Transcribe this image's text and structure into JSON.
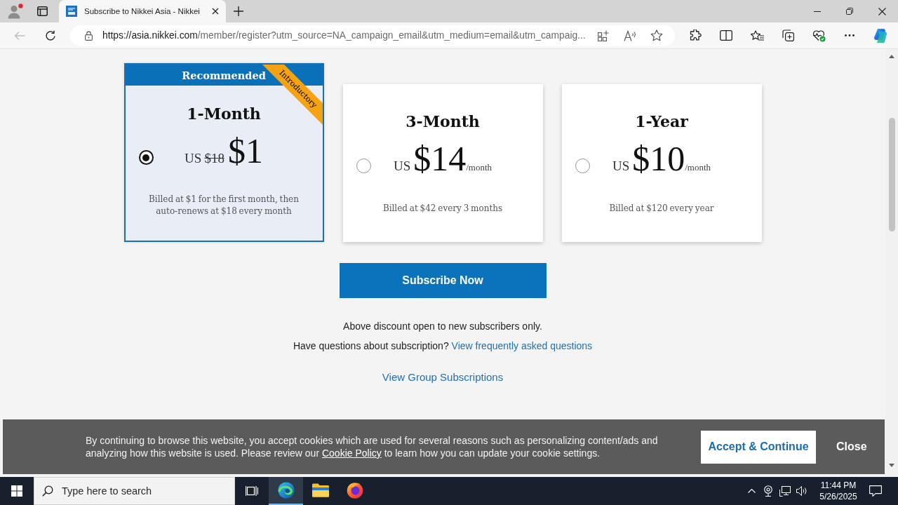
{
  "browser": {
    "tabs": [
      {
        "title": "Subscribe to Nikkei Asia - Nikkei",
        "selected": true
      }
    ],
    "back_disabled": true,
    "address_bar": {
      "url_host": "https://asia.nikkei.com",
      "url_path": "/member/register?utm_source=NA_campaign_email&utm_medium=email&utm_campaig..."
    }
  },
  "plans": [
    {
      "header": "Recommended",
      "ribbon": "Introductory",
      "title": "1-Month",
      "currency": "US",
      "old_price": "$18",
      "price": "$1",
      "note": "Billed at $1 for the first month, then auto-renews at $18 every month",
      "selected": true
    },
    {
      "title": "3-Month",
      "currency": "US",
      "price": "$14",
      "unit": "/month",
      "note": "Billed at $42 every 3 months",
      "selected": false
    },
    {
      "title": "1-Year",
      "currency": "US",
      "price": "$10",
      "unit": "/month",
      "note": "Billed at $120 every year",
      "selected": false
    }
  ],
  "subscribe_button": "Subscribe Now",
  "notes": {
    "discount": "Above discount open to new subscribers only.",
    "faq_prompt": "Have questions about subscription?",
    "faq_link": "View frequently asked questions",
    "group_link": "View Group Subscriptions"
  },
  "cookie_banner": {
    "text_before": "By continuing to browse this website, you accept cookies which are used for several reasons such as personalizing content/ads and analyzing how this website is used. Please review our",
    "link": "Cookie Policy",
    "text_after": "to learn how you can update your cookie settings.",
    "accept_button": "Accept & Continue",
    "close_button": "Close"
  },
  "taskbar": {
    "search_placeholder": "Type here to search",
    "apps": [
      {
        "kind": "edge",
        "active": true
      },
      {
        "kind": "explorer",
        "active": false
      },
      {
        "kind": "firefox",
        "active": false
      }
    ],
    "time": "11:44 PM",
    "date": "5/26/2025"
  }
}
